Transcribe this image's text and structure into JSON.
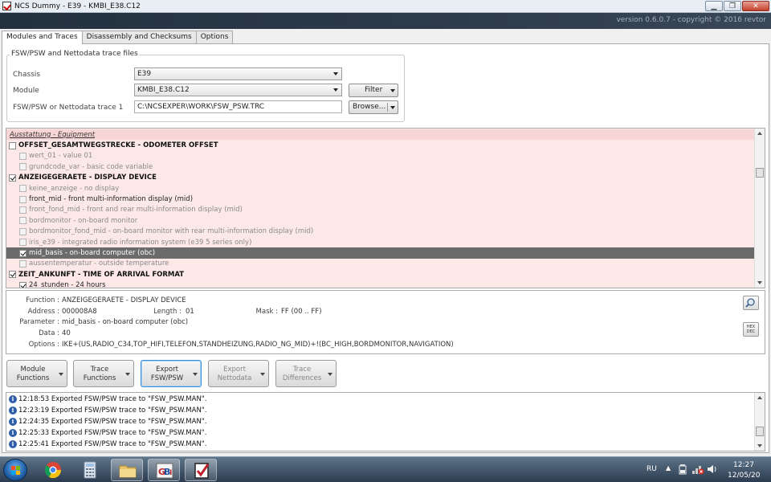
{
  "window": {
    "title": "NCS Dummy - E39 - KMBI_E38.C12",
    "version": "version 0.6.0.7 - copyright © 2016 revtor",
    "controls": [
      "minimize",
      "restore",
      "close"
    ]
  },
  "tabs": [
    {
      "label": "Modules and Traces",
      "active": true
    },
    {
      "label": "Disassembly and Checksums",
      "active": false
    },
    {
      "label": "Options",
      "active": false
    }
  ],
  "trace_files": {
    "group_title": "FSW/PSW and Nettodata trace files",
    "chassis_label": "Chassis",
    "chassis_value": "E39",
    "module_label": "Module",
    "module_value": "KMBI_E38.C12",
    "filter_label": "Filter",
    "trace_label": "FSW/PSW or Nettodata trace 1",
    "trace_value": "C:\\NCSEXPER\\WORK\\FSW_PSW.TRC",
    "browse_label": "Browse..."
  },
  "tree": {
    "header": "Ausstattung  -  Equipment",
    "rows": [
      {
        "text": "OFFSET_GESAMTWEGSTRECKE  -  ODOMETER OFFSET",
        "level": 0,
        "checked": false,
        "group": true
      },
      {
        "text": "wert_01  -  value 01",
        "level": 1,
        "checked": false
      },
      {
        "text": "grundcode_var  -  basic code variable",
        "level": 1,
        "checked": false
      },
      {
        "text": "ANZEIGEGERAETE  -  DISPLAY DEVICE",
        "level": 0,
        "checked": true,
        "group": true
      },
      {
        "text": "keine_anzeige  -  no display",
        "level": 1,
        "checked": false
      },
      {
        "text": "front_mid  -  front multi-information display (mid)",
        "level": 1,
        "checked": false,
        "strong": true
      },
      {
        "text": "front_fond_mid  -  front and rear multi-information display (mid)",
        "level": 1,
        "checked": false
      },
      {
        "text": "bordmonitor  -  on-board monitor",
        "level": 1,
        "checked": false
      },
      {
        "text": "bordmonitor_fond_mid  -  on-board monitor with rear multi-information display (mid)",
        "level": 1,
        "checked": false
      },
      {
        "text": "iris_e39  -  integrated radio information system (e39 5 series only)",
        "level": 1,
        "checked": false
      },
      {
        "text": "mid_basis  -  on-board computer (obc)",
        "level": 1,
        "checked": true,
        "selected": true
      },
      {
        "text": "aussentemperatur  -  outside temperature",
        "level": 1,
        "checked": false
      },
      {
        "text": "ZEIT_ANKUNFT  -  TIME OF ARRIVAL FORMAT",
        "level": 0,
        "checked": true,
        "group": true
      },
      {
        "text": "24_stunden  -  24 hours",
        "level": 1,
        "checked": true,
        "strong": true
      }
    ]
  },
  "details": {
    "function_label": "Function :",
    "function_value": "ANZEIGEGERAETE  -  DISPLAY DEVICE",
    "address_label": "Address :",
    "address_value": "000008A8",
    "length_label": "Length :",
    "length_value": "01",
    "mask_label": "Mask :",
    "mask_value": "FF  (00 .. FF)",
    "parameter_label": "Parameter :",
    "parameter_value": "mid_basis  -  on-board computer (obc)",
    "data_label": "Data :",
    "data_value": "40",
    "options_label": "Options :",
    "options_value": "IKE+(US,RADIO_C34,TOP_HIFI,TELEFON,STANDHEIZUNG,RADIO_NG_MID)+!(BC_HIGH,BORDMONITOR,NAVIGATION)",
    "hex_dec_label": "HEX DEC"
  },
  "function_buttons": [
    {
      "line1": "Module",
      "line2": "Functions"
    },
    {
      "line1": "Trace",
      "line2": "Functions"
    },
    {
      "line1": "Export",
      "line2": "FSW/PSW"
    },
    {
      "line1": "Export",
      "line2": "Nettodata"
    },
    {
      "line1": "Trace",
      "line2": "Differences"
    }
  ],
  "log": [
    {
      "time": "12:18:53",
      "message": "Exported FSW/PSW trace to \"FSW_PSW.MAN\"."
    },
    {
      "time": "12:23:19",
      "message": "Exported FSW/PSW trace to \"FSW_PSW.MAN\"."
    },
    {
      "time": "12:24:35",
      "message": "Exported FSW/PSW trace to \"FSW_PSW.MAN\"."
    },
    {
      "time": "12:25:33",
      "message": "Exported FSW/PSW trace to \"FSW_PSW.MAN\"."
    },
    {
      "time": "12:25:41",
      "message": "Exported FSW/PSW trace to \"FSW_PSW.MAN\"."
    }
  ],
  "taskbar": {
    "language": "RU",
    "time": "12:27",
    "date": "12/05/20",
    "pinned": [
      "windows-start",
      "chrome",
      "calculator",
      "file-explorer",
      "gbi-app",
      "ncs-dummy"
    ]
  },
  "colors": {
    "tree_background": "#fde8e8",
    "selected_row": "#6b6b6b",
    "banner": "#2e3b4b",
    "info_icon": "#2f5ea8"
  }
}
